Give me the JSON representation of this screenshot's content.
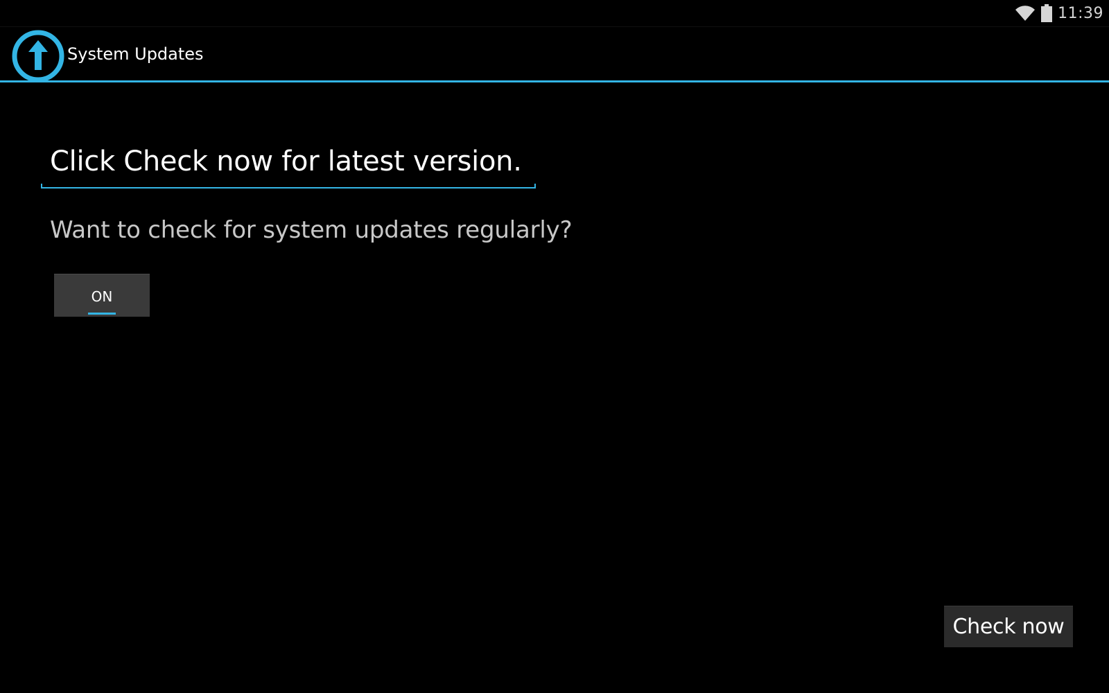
{
  "status_bar": {
    "time": "11:39",
    "wifi_icon": "wifi-icon",
    "battery_icon": "battery-icon"
  },
  "action_bar": {
    "app_icon": "system-update-arrow-icon",
    "title": "System Updates"
  },
  "main": {
    "status_message": "Click Check now for latest version.",
    "question": "Want to check for system updates regularly?",
    "toggle": {
      "label": "ON",
      "state": "on"
    },
    "check_now_label": "Check now"
  },
  "colors": {
    "accent": "#33b5e5",
    "background": "#000000",
    "button_bg": "#2b2b2b",
    "toggle_bg": "#3a3a3a"
  }
}
